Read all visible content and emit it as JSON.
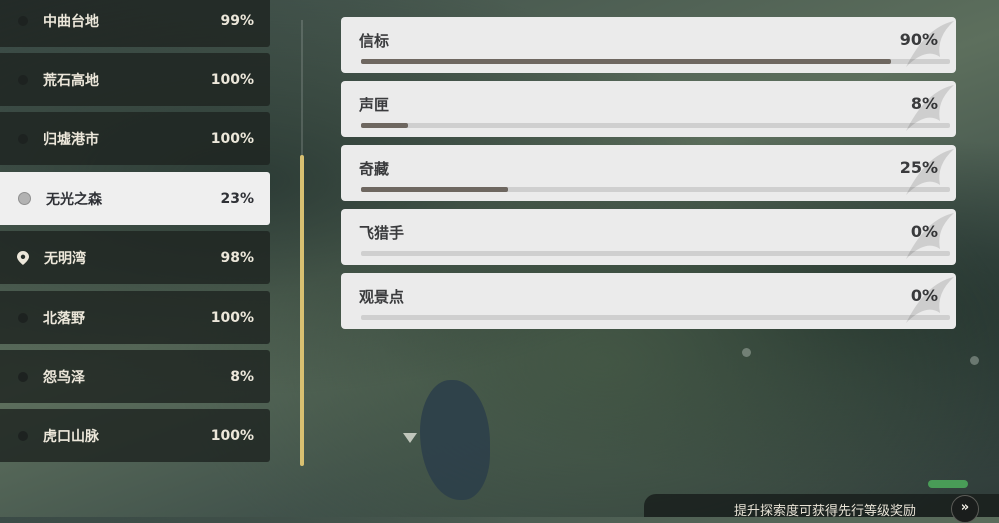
{
  "regions": [
    {
      "name": "中曲台地",
      "percent": "99%",
      "icon": "bullet-icon"
    },
    {
      "name": "荒石高地",
      "percent": "100%",
      "icon": "bullet-icon"
    },
    {
      "name": "归墟港市",
      "percent": "100%",
      "icon": "bullet-icon"
    },
    {
      "name": "无光之森",
      "percent": "23%",
      "icon": "bullet-icon",
      "selected": true
    },
    {
      "name": "无明湾",
      "percent": "98%",
      "icon": "location-pin-icon"
    },
    {
      "name": "北落野",
      "percent": "100%",
      "icon": "bullet-icon"
    },
    {
      "name": "怨鸟泽",
      "percent": "8%",
      "icon": "bullet-icon"
    },
    {
      "name": "虎口山脉",
      "percent": "100%",
      "icon": "bullet-icon"
    }
  ],
  "categories": [
    {
      "name": "信标",
      "percent": "90%",
      "progress": 0.9
    },
    {
      "name": "声匣",
      "percent": "8%",
      "progress": 0.08
    },
    {
      "name": "奇藏",
      "percent": "25%",
      "progress": 0.25
    },
    {
      "name": "飞猎手",
      "percent": "0%",
      "progress": 0.0
    },
    {
      "name": "观景点",
      "percent": "0%",
      "progress": 0.0
    }
  ],
  "hint": {
    "text": "提升探索度可获得先行等级奖励",
    "button": "»"
  },
  "colors": {
    "selected_bg": "#efefef",
    "progress_fill": "#6e6760",
    "scroll_accent": "#d8c071"
  }
}
